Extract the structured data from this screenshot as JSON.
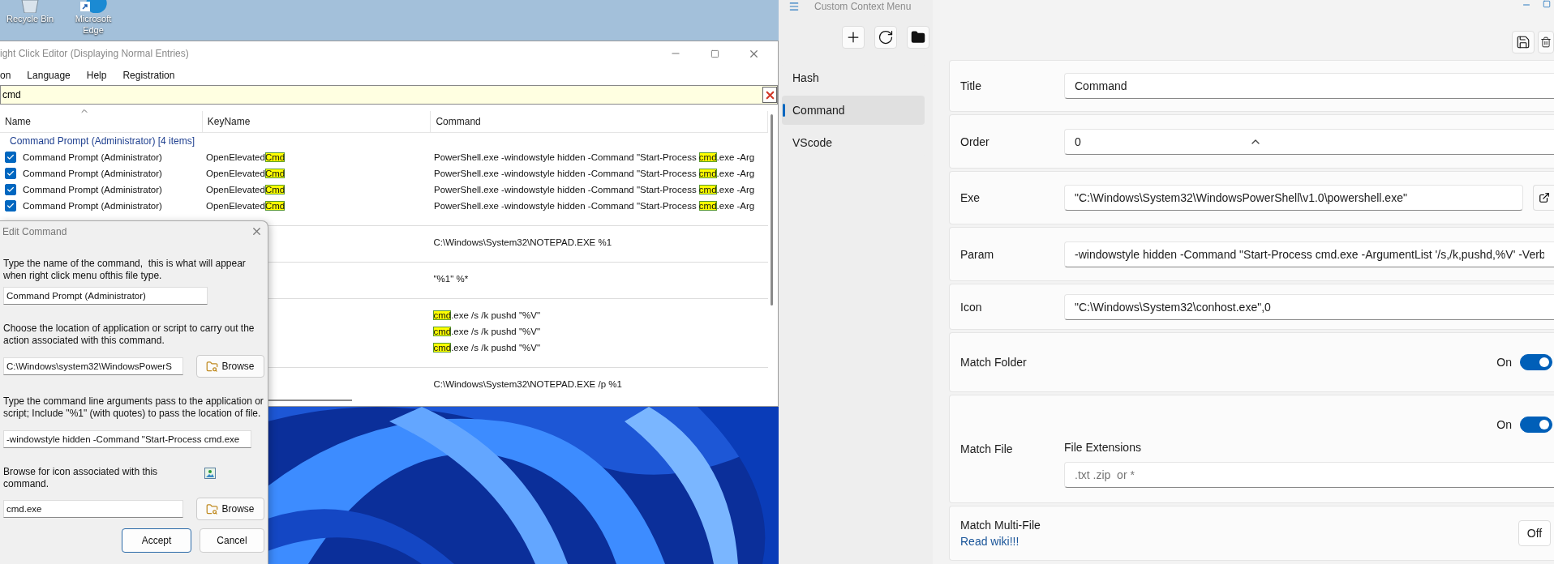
{
  "desktop": {
    "icons": [
      {
        "kind": "recycle_bin",
        "label": "Recycle Bin"
      },
      {
        "kind": "edge",
        "label": "Microsoft Edge"
      }
    ]
  },
  "editor": {
    "title": "ight Click Editor (Displaying Normal Entries)",
    "menu": [
      "on",
      "Language",
      "Help",
      "Registration"
    ],
    "filter": {
      "value": "cmd"
    },
    "columns": [
      "Name",
      "KeyName",
      "Command"
    ],
    "group": {
      "header": "Command Prompt (Administrator) [4 items]",
      "rows": [
        {
          "checked": true,
          "name": "Command Prompt (Administrator)",
          "key_name": [
            {
              "text": "OpenElevated",
              "highlight": false
            },
            {
              "text": "Cmd",
              "highlight": true
            }
          ],
          "command": [
            {
              "text": "PowerShell.exe -windowstyle hidden -Command \"Start-Process ",
              "highlight": false
            },
            {
              "text": "cmd",
              "highlight": true
            },
            {
              "text": ".exe -Arg",
              "highlight": false
            }
          ]
        },
        {
          "checked": true,
          "name": "Command Prompt (Administrator)",
          "key_name": [
            {
              "text": "OpenElevated",
              "highlight": false
            },
            {
              "text": "Cmd",
              "highlight": true
            }
          ],
          "command": [
            {
              "text": "PowerShell.exe -windowstyle hidden -Command \"Start-Process ",
              "highlight": false
            },
            {
              "text": "cmd",
              "highlight": true
            },
            {
              "text": ".exe -Arg",
              "highlight": false
            }
          ]
        },
        {
          "checked": true,
          "name": "Command Prompt (Administrator)",
          "key_name": [
            {
              "text": "OpenElevated",
              "highlight": false
            },
            {
              "text": "Cmd",
              "highlight": true
            }
          ],
          "command": [
            {
              "text": "PowerShell.exe -windowstyle hidden -Command \"Start-Process ",
              "highlight": false
            },
            {
              "text": "cmd",
              "highlight": true
            },
            {
              "text": ".exe -Arg",
              "highlight": false
            }
          ]
        },
        {
          "checked": true,
          "name": "Command Prompt (Administrator)",
          "key_name": [
            {
              "text": "OpenElevated",
              "highlight": false
            },
            {
              "text": "Cmd",
              "highlight": true
            }
          ],
          "command": [
            {
              "text": "PowerShell.exe -windowstyle hidden -Command \"Start-Process ",
              "highlight": false
            },
            {
              "text": "cmd",
              "highlight": true
            },
            {
              "text": ".exe -Arg",
              "highlight": false
            }
          ]
        }
      ]
    },
    "blocks": [
      {
        "rows": [
          {
            "command": [
              {
                "text": "C:\\Windows\\System32\\NOTEPAD.EXE %1",
                "highlight": false
              }
            ]
          }
        ]
      },
      {
        "rows": [
          {
            "command": [
              {
                "text": "\"%1\" %*",
                "highlight": false
              }
            ]
          }
        ]
      },
      {
        "rows": [
          {
            "command": [
              {
                "text": "cmd",
                "highlight": true
              },
              {
                "text": ".exe /s /k pushd \"%V\"",
                "highlight": false
              }
            ]
          },
          {
            "command": [
              {
                "text": "cmd",
                "highlight": true
              },
              {
                "text": ".exe /s /k pushd \"%V\"",
                "highlight": false
              }
            ]
          },
          {
            "command": [
              {
                "text": "cmd",
                "highlight": true
              },
              {
                "text": ".exe /s /k pushd \"%V\"",
                "highlight": false
              }
            ]
          }
        ]
      },
      {
        "rows": [
          {
            "command": [
              {
                "text": "C:\\Windows\\System32\\NOTEPAD.EXE /p %1",
                "highlight": false
              }
            ]
          }
        ]
      }
    ]
  },
  "dialog": {
    "title": "Edit Command",
    "sections": [
      {
        "kind": "field",
        "prompt": "Type the name of the command,  this is what will appear when right click menu ofthis file type.",
        "value": "Command Prompt (Administrator)"
      },
      {
        "kind": "browse",
        "prompt": "Choose the location of application or script to carry out the action associated with this command.",
        "value": "C:\\Windows\\system32\\WindowsPowerS",
        "button": "Browse"
      },
      {
        "kind": "field",
        "prompt": "Type the command line arguments pass to the application or script; Include \"%1\" (with quotes) to pass the location of file.",
        "value": "-windowstyle hidden -Command \"Start-Process cmd.exe"
      },
      {
        "kind": "icon_browse",
        "prompt": "Browse for icon associated with this command.",
        "value": "cmd.exe",
        "button": "Browse"
      }
    ],
    "buttons": [
      {
        "label": "Accept",
        "default": true
      },
      {
        "label": "Cancel",
        "default": false
      }
    ]
  },
  "app": {
    "title": "Custom Context Menu",
    "sidebar": [
      {
        "label": "Hash",
        "selected": false
      },
      {
        "label": "Command",
        "selected": true
      },
      {
        "label": "VScode",
        "selected": false
      }
    ],
    "fields": [
      {
        "kind": "text",
        "label": "Title",
        "value": "Command"
      },
      {
        "kind": "number",
        "label": "Order",
        "value": "0"
      },
      {
        "kind": "file",
        "label": "Exe",
        "value": "\"C:\\Windows\\System32\\WindowsPowerShell\\v1.0\\powershell.exe\""
      },
      {
        "kind": "text",
        "label": "Param",
        "value": "-windowstyle hidden -Command \"Start-Process cmd.exe -ArgumentList '/s,/k,pushd,%V' -Verb"
      },
      {
        "kind": "text",
        "label": "Icon",
        "value": "\"C:\\Windows\\System32\\conhost.exe\",0"
      },
      {
        "kind": "switch",
        "label": "Match Folder",
        "state_text": "On",
        "on": true
      },
      {
        "kind": "extensions",
        "label": "Match File",
        "state_text": "On",
        "on": true,
        "sublabel": "File Extensions",
        "placeholder": ".txt .zip  or *"
      },
      {
        "kind": "option",
        "label": "Match Multi-File",
        "link": "Read wiki!!!",
        "value": "Off"
      }
    ]
  }
}
